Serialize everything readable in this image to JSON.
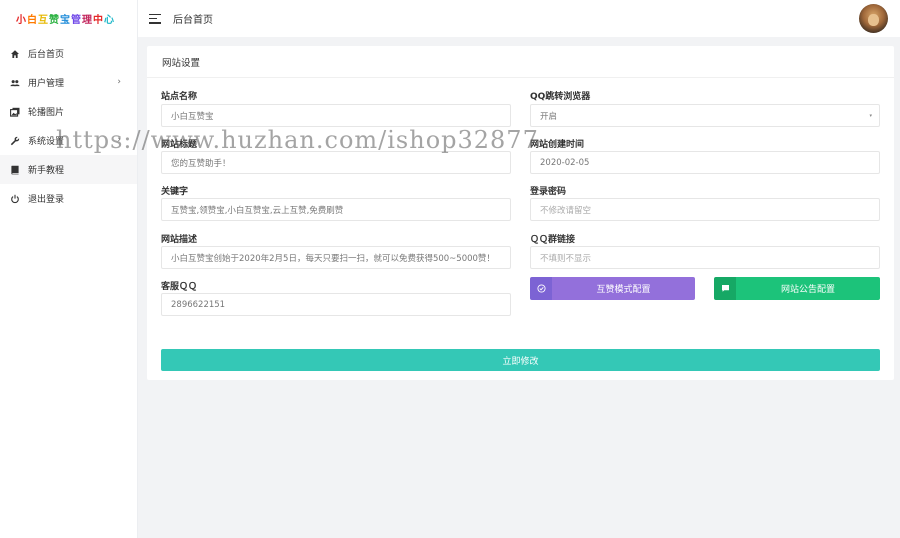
{
  "app": {
    "logo_chars": [
      {
        "ch": "小",
        "color": "#e52828"
      },
      {
        "ch": "白",
        "color": "#ff7a00"
      },
      {
        "ch": "互",
        "color": "#e6b800"
      },
      {
        "ch": "赞",
        "color": "#2fb344"
      },
      {
        "ch": "宝",
        "color": "#1d8bd8"
      },
      {
        "ch": "管",
        "color": "#7048e8"
      },
      {
        "ch": "理",
        "color": "#c2255c"
      },
      {
        "ch": "中",
        "color": "#e52828"
      },
      {
        "ch": "心",
        "color": "#1fb8c9"
      }
    ]
  },
  "sidebar": {
    "items": [
      {
        "label": "后台首页",
        "icon": "home-icon"
      },
      {
        "label": "用户管理",
        "icon": "users-icon",
        "arrow": "›"
      },
      {
        "label": "轮播图片",
        "icon": "images-icon"
      },
      {
        "label": "系统设置",
        "icon": "wrench-icon",
        "arrow": "›"
      },
      {
        "label": "新手教程",
        "icon": "book-icon"
      },
      {
        "label": "退出登录",
        "icon": "power-icon"
      }
    ]
  },
  "topbar": {
    "title": "后台首页"
  },
  "card": {
    "title": "网站设置",
    "left": [
      {
        "label": "站点名称",
        "value": "小白互赞宝"
      },
      {
        "label": "网站标题",
        "value": "您的互赞助手！"
      },
      {
        "label": "关键字",
        "value": "互赞宝,领赞宝,小白互赞宝,云上互赞,免费刷赞"
      },
      {
        "label": "网站描述",
        "value": "小白互赞宝创始于2020年2月5日，每天只要扫一扫，就可以免费获得500~5000赞！"
      },
      {
        "label": "客服ＱＱ",
        "value": "2896622151"
      }
    ],
    "right": [
      {
        "label": "QQ跳转浏览器",
        "value": "开启",
        "type": "select",
        "arrow": "▾"
      },
      {
        "label": "网站创建时间",
        "value": "2020-02-05"
      },
      {
        "label": "登录密码",
        "placeholder": "不修改请留空"
      },
      {
        "label": "ＱＱ群链接",
        "placeholder": "不填则不显示"
      }
    ],
    "buttons": {
      "mode": "互赞模式配置",
      "notice": "网站公告配置"
    },
    "submit": "立即修改"
  },
  "watermark": "https://www.huzhan.com/ishop32877"
}
